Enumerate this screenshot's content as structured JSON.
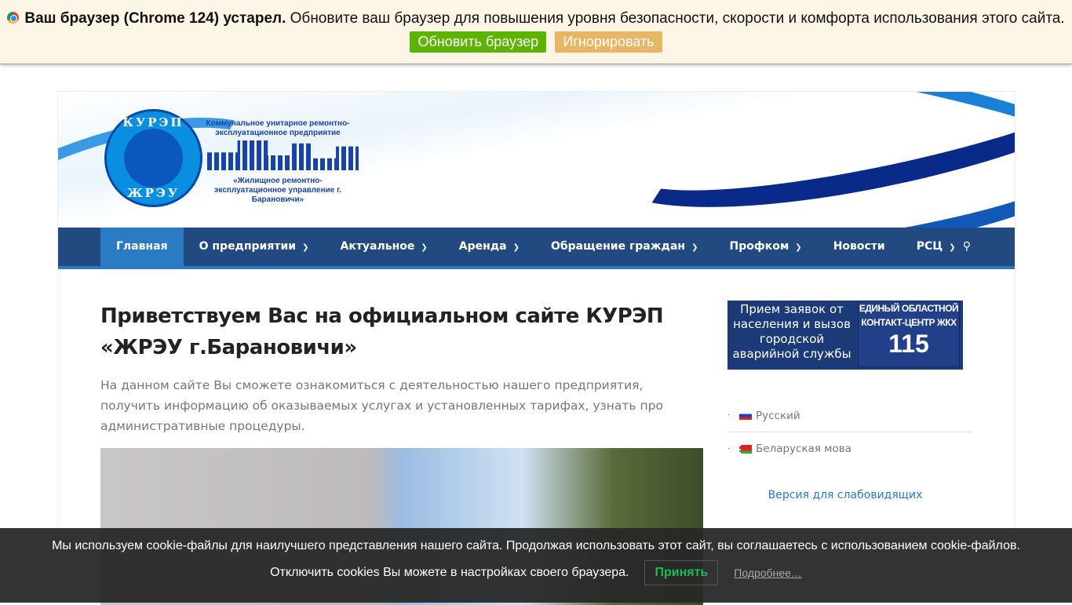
{
  "update_bar": {
    "bold": "Ваш браузер (Chrome 124) устарел.",
    "text": " Обновите ваш браузер для повышения уровня безопасности, скорости и комфорта использования этого сайта.",
    "update_label": "Обновить браузер",
    "ignore_label": "Игнорировать",
    "update_color": "#5cb300",
    "ignore_color": "#e9b665"
  },
  "logo": {
    "top": "КУРЭП",
    "bottom": "ЖРЭУ",
    "city": "БАРАНОВИЧИ",
    "line1": "Коммунальное унитарное ремонтно-эксплуатационное предприятие",
    "line2": "«Жилищное ремонтно-эксплуатационное управление г. Барановичи»"
  },
  "nav": {
    "items": [
      {
        "label": "Главная"
      },
      {
        "label": "О предприятии"
      },
      {
        "label": "Актуальное"
      },
      {
        "label": "Аренда"
      },
      {
        "label": "Обращение граждан"
      },
      {
        "label": "Профком"
      },
      {
        "label": "Новости"
      },
      {
        "label": "РСЦ"
      }
    ],
    "search_icon": "search-icon"
  },
  "main": {
    "title": "Приветствуем Вас на официальном сайте КУРЭП «ЖРЭУ г.Барановичи»",
    "intro": "На данном сайте Вы сможете ознакомиться с деятельностью нашего предприятия, получить информацию об оказываемых услугах и установленных тарифах, узнать про административные процедуры."
  },
  "sidebar": {
    "ad_left": "Прием заявок от населения и вызов городской аварийной службы",
    "ad_right": "ЕДИНЫЙ ОБЛАСТНОЙ КОНТАКТ-ЦЕНТР ЖКХ",
    "ad_number": "115",
    "languages": [
      {
        "label": "Русский"
      },
      {
        "label": "Беларуская мова"
      }
    ],
    "low_vision": "Версия для слабовидящих"
  },
  "cookie": {
    "line1": "Мы используем cookie-файлы для наилучшего представления нашего сайта. Продолжая использовать этот сайт, вы соглашаетесь с использованием cookie-файлов.",
    "line2": "Отключить cookies Вы можете в настройках своего браузера.",
    "accept": "Принять",
    "more": "Подробнее…"
  }
}
